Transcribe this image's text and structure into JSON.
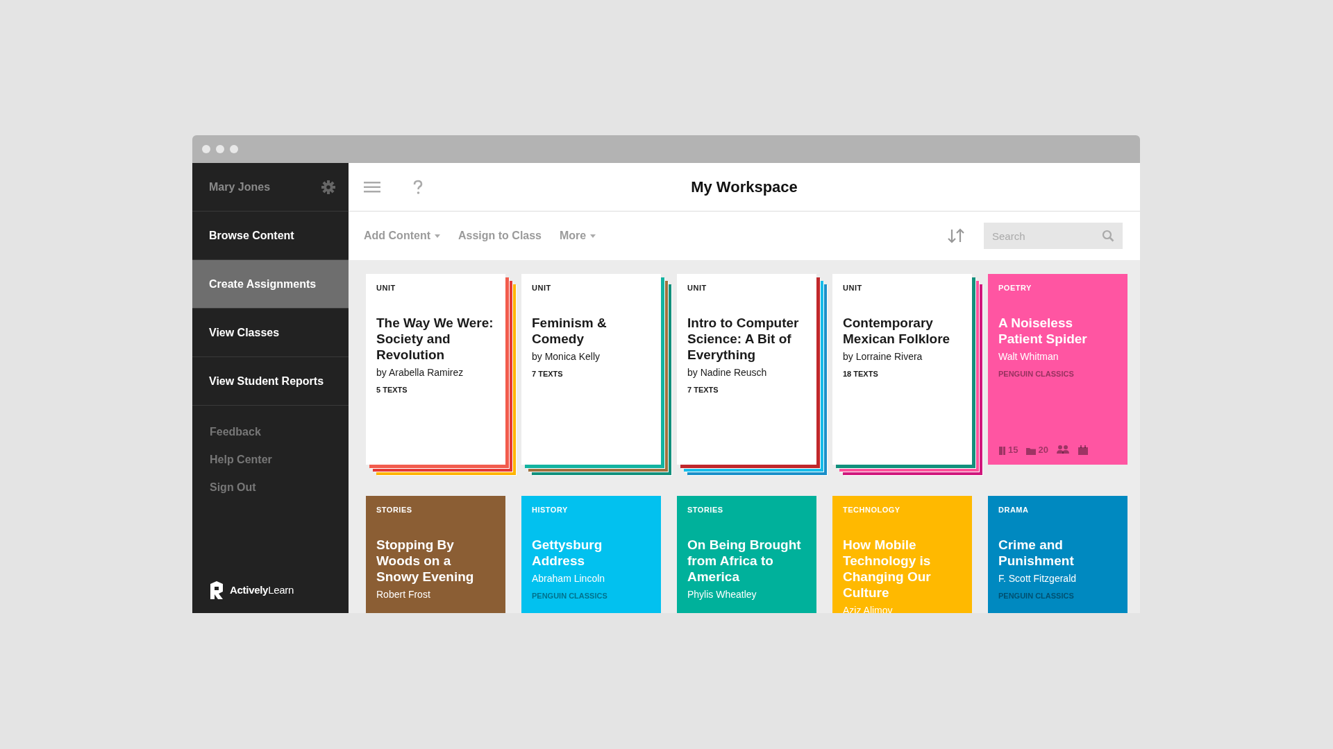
{
  "user": {
    "name": "Mary Jones"
  },
  "nav": [
    {
      "label": "Browse Content",
      "selected": false
    },
    {
      "label": "Create Assignments",
      "selected": true
    },
    {
      "label": "View Classes",
      "selected": false
    },
    {
      "label": "View Student Reports",
      "selected": false
    }
  ],
  "secondary_links": [
    "Feedback",
    "Help Center",
    "Sign Out"
  ],
  "brand": {
    "logo_text": "**Actively**Learn"
  },
  "header": {
    "title": "My Workspace"
  },
  "toolbar": {
    "actions": [
      {
        "label": "Add Content",
        "dropdown": true
      },
      {
        "label": "Assign to Class",
        "dropdown": false
      },
      {
        "label": "More",
        "dropdown": true
      }
    ],
    "search": {
      "placeholder": "Search"
    }
  },
  "cards": [
    {
      "kind": "unit",
      "label": "UNIT",
      "title": "The Way We Were: Society and Revolution",
      "author": "by Arabella Ramirez",
      "count": "5 TEXTS",
      "stack": [
        {
          "color": "#f25c4d"
        },
        {
          "color": "#e53935"
        },
        {
          "color": "#ffb400"
        }
      ]
    },
    {
      "kind": "unit",
      "label": "UNIT",
      "title": "Feminism & Comedy",
      "author": "by Monica Kelly",
      "count": "7 TEXTS",
      "stack": [
        {
          "color": "#13b3a0"
        },
        {
          "color": "#a0703c"
        },
        {
          "color": "#12907c"
        }
      ]
    },
    {
      "kind": "unit",
      "label": "UNIT",
      "title": "Intro to Computer Science: A Bit of Everything",
      "author": "by Nadine Reusch",
      "count": "7 TEXTS",
      "stack": [
        {
          "color": "#c0282c"
        },
        {
          "color": "#16bdea"
        },
        {
          "color": "#1a8fc9"
        }
      ]
    },
    {
      "kind": "unit",
      "label": "UNIT",
      "title": "Contemporary Mexican Folklore",
      "author": "by Lorraine Rivera",
      "count": "18 TEXTS",
      "stack": [
        {
          "color": "#12907c"
        },
        {
          "color": "#ff4f9a"
        },
        {
          "color": "#d0187c"
        }
      ]
    },
    {
      "kind": "text",
      "label": "POETRY",
      "title": "A Noiseless Patient Spider",
      "author": "Walt Whitman",
      "publisher": "PENGUIN CLASSICS",
      "color": "#ff55a2",
      "stats": [
        {
          "kind": "book",
          "value": "15"
        },
        {
          "kind": "folder",
          "value": "20"
        },
        {
          "kind": "people"
        },
        {
          "kind": "calendar"
        }
      ]
    },
    {
      "kind": "text",
      "label": "STORIES",
      "title": "Stopping By Woods on a Snowy Evening",
      "author": "Robert Frost",
      "color": "#8b5e34"
    },
    {
      "kind": "text",
      "label": "HISTORY",
      "title": "Gettysburg Address",
      "author": "Abraham Lincoln",
      "publisher": "PENGUIN CLASSICS",
      "color": "#02c1ef"
    },
    {
      "kind": "text",
      "label": "STORIES",
      "title": "On Being Brought from Africa to America",
      "author": "Phylis Wheatley",
      "color": "#00b19b"
    },
    {
      "kind": "text",
      "label": "TECHNOLOGY",
      "title": "How Mobile Technology is Changing Our Culture",
      "author": "Aziz Alimov",
      "color": "#ffb900"
    },
    {
      "kind": "text",
      "label": "DRAMA",
      "title": "Crime and Punishment",
      "author": "F. Scott Fitzgerald",
      "publisher": "PENGUIN CLASSICS",
      "color": "#0089c0"
    }
  ]
}
